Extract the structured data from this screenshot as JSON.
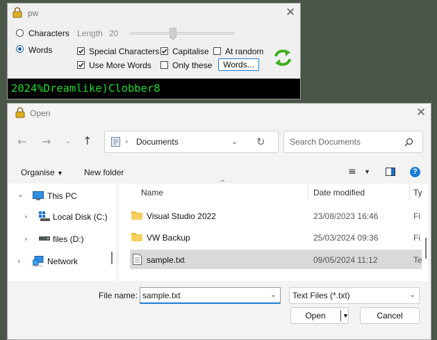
{
  "pw": {
    "title": "pw",
    "mode_characters": "Characters",
    "mode_words": "Words",
    "length_label": "Length",
    "length_value": "20",
    "slider_level": 0.38,
    "opt_special": "Special Characters",
    "opt_capitalise": "Capitalise",
    "opt_at_random": "At random",
    "opt_more_words": "Use More Words",
    "opt_only_these": "Only these",
    "words_button": "Words...",
    "output": "2024%Dreamlike)Clobber8"
  },
  "open_dialog": {
    "title": "Open",
    "path": "Documents",
    "search_placeholder": "Search Documents",
    "organise": "Organise",
    "new_folder": "New folder",
    "tree": [
      {
        "label": "This PC"
      },
      {
        "label": "Local Disk (C:)"
      },
      {
        "label": "files (D:)"
      },
      {
        "label": "Network"
      }
    ],
    "columns": {
      "name": "Name",
      "date": "Date modified",
      "type": "Ty"
    },
    "rows": [
      {
        "name": "Visual Studio 2022",
        "date": "23/08/2023 16:46",
        "type": "Fi"
      },
      {
        "name": "VW Backup",
        "date": "25/03/2024 09:36",
        "type": "Fi"
      },
      {
        "name": "sample.txt",
        "date": "09/05/2024 11:12",
        "type": "Te"
      }
    ],
    "file_name_label": "File name:",
    "file_name_value": "sample.txt",
    "file_type": "Text Files (*.txt)",
    "open_button": "Open",
    "cancel_button": "Cancel"
  },
  "colors": {
    "accent": "#1c7cd6",
    "terminal_text": "#1edc2a",
    "selected_row": "#d9d9d9",
    "desktop": "#4a5748"
  }
}
